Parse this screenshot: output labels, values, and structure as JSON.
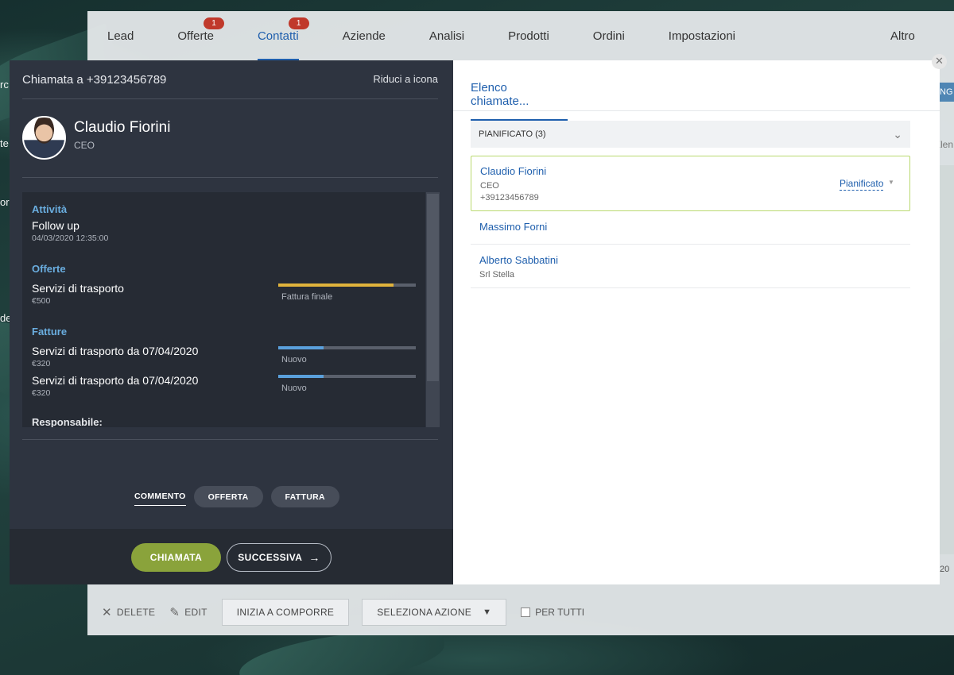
{
  "nav": {
    "tabs": [
      {
        "label": "Lead",
        "badge": ""
      },
      {
        "label": "Offerte",
        "badge": "1"
      },
      {
        "label": "Contatti",
        "badge": "1",
        "active": true
      },
      {
        "label": "Aziende",
        "badge": ""
      },
      {
        "label": "Analisi",
        "badge": ""
      },
      {
        "label": "Prodotti",
        "badge": ""
      },
      {
        "label": "Ordini",
        "badge": ""
      },
      {
        "label": "Impostazioni",
        "badge": ""
      },
      {
        "label": "Altro",
        "badge": ""
      }
    ]
  },
  "background": {
    "btn_fragment": "NG",
    "gray_fragment": "Elen",
    "left_fragments": [
      "rc",
      "te",
      "or",
      "de"
    ],
    "number_fragment": "20"
  },
  "call_panel": {
    "header_title": "Chiamata a +39123456789",
    "minimize_label": "Riduci a icona",
    "contact_name": "Claudio Fiorini",
    "contact_role": "CEO",
    "activities_title": "Attività",
    "activity_title": "Follow up",
    "activity_date": "04/03/2020 12:35:00",
    "offers_title": "Offerte",
    "offer": {
      "title": "Servizi di trasporto",
      "amount": "€500",
      "status": "Fattura finale",
      "progress": 0.84
    },
    "invoices_title": "Fatture",
    "invoices": [
      {
        "title": "Servizi di trasporto da 07/04/2020",
        "amount": "€320",
        "status": "Nuovo",
        "progress": 0.33
      },
      {
        "title": "Servizi di trasporto da 07/04/2020",
        "amount": "€320",
        "status": "Nuovo",
        "progress": 0.33
      }
    ],
    "responsabile_label": "Responsabile:",
    "subtabs": [
      "COMMENTO",
      "OFFERTA",
      "FATTURA"
    ],
    "call_button": "CHIAMATA",
    "next_button": "SUCCESSIVA",
    "next_icon": "arrow-right-icon"
  },
  "call_list": {
    "tab_label": "Elenco chiamate...",
    "group_label": "PIANIFICATO (3)",
    "items": [
      {
        "name": "Claudio Fiorini",
        "line1": "CEO",
        "line2": "+39123456789",
        "status": "Pianificato"
      },
      {
        "name": "Massimo Forni",
        "line1": "",
        "line2": ""
      },
      {
        "name": "Alberto Sabbatini",
        "line1": "Srl Stella",
        "line2": ""
      }
    ]
  },
  "toolbar": {
    "delete_label": "DELETE",
    "edit_label": "EDIT",
    "start_dial_label": "INIZIA A COMPORRE",
    "select_action_label": "SELEZIONA AZIONE",
    "for_all_label": "PER TUTTI"
  },
  "colors": {
    "accent_blue": "#1f5fad",
    "call_green": "#8aa33b",
    "progress_yellow": "#e0b33c",
    "progress_blue": "#5aa0dc",
    "badge_red": "#c0392b",
    "panel_dark": "#2e3440"
  }
}
